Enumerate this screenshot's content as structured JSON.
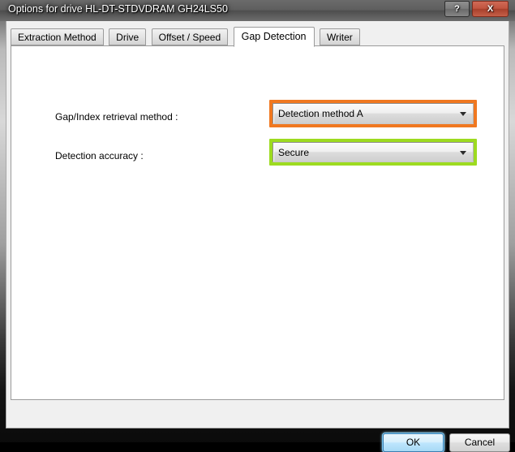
{
  "window": {
    "title": "Options for drive HL-DT-STDVDRAM GH24LS50",
    "help_label": "?",
    "close_label": "X"
  },
  "tabs": [
    {
      "label": "Extraction Method",
      "active": false
    },
    {
      "label": "Drive",
      "active": false
    },
    {
      "label": "Offset / Speed",
      "active": false
    },
    {
      "label": "Gap Detection",
      "active": true
    },
    {
      "label": "Writer",
      "active": false
    }
  ],
  "form": {
    "rows": [
      {
        "label": "Gap/Index retrieval method :",
        "value": "Detection method A",
        "highlight_color": "#f07820",
        "options": [
          "Detection method A"
        ]
      },
      {
        "label": "Detection accuracy :",
        "value": "Secure",
        "highlight_color": "#9ddb20",
        "options": [
          "Secure"
        ]
      }
    ]
  },
  "footer": {
    "ok_label": "OK",
    "cancel_label": "Cancel"
  },
  "icons": {
    "dropdown": "chevron-down-icon",
    "help": "question-mark-icon",
    "close": "close-icon"
  },
  "colors": {
    "highlight_orange": "#f07820",
    "highlight_green": "#9ddb20",
    "titlebar": "#5f5f5f",
    "accent_focus": "#3c7fb1"
  }
}
